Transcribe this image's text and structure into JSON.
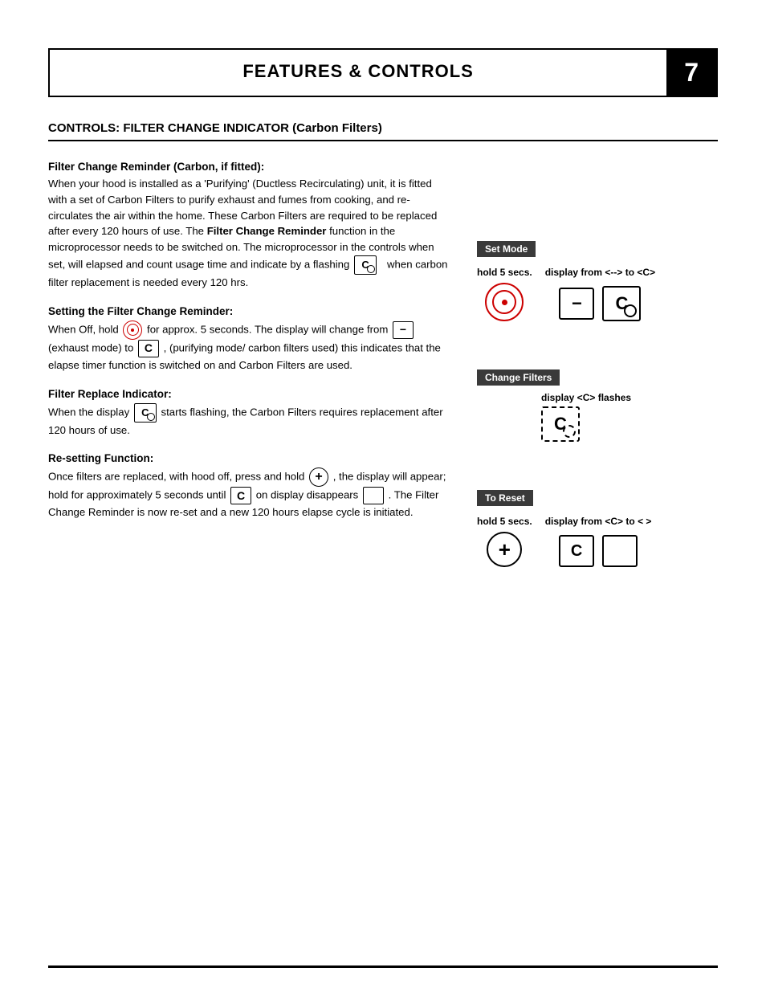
{
  "header": {
    "title": "FEATURES & CONTROLS",
    "page_number": "7"
  },
  "section_heading": "CONTROLS: FILTER CHANGE INDICATOR (Carbon Filters)",
  "filter_change_reminder": {
    "heading": "Filter Change Reminder (Carbon, if fitted):",
    "paragraph1": "When your hood is installed as a 'Purifying' (Ductless Recirculating) unit, it is fitted with a set of Carbon Filters to purify exhaust and fumes from cooking, and re-circulates the air within the home.  These Carbon Filters are required to be replaced after every 120 hours of use.  The ",
    "bold_text": "Filter Change Reminder",
    "paragraph2": " function in the microprocessor needs to be switched on.  The microprocessor in the controls when set, will elapsed and count usage time and indicate by a flashing ",
    "paragraph3": "   when carbon filter replacement is needed every 120 hrs."
  },
  "setting_filter": {
    "heading": "Setting the Filter Change Reminder:",
    "paragraph": "When Off, hold ",
    "para_mid1": "  for approx. 5 seconds. The display will change from ",
    "para_mid2": " (exhaust mode) to ",
    "para_mid3": " , (purifying mode/ carbon filters used) this indicates that the elapse timer function is switched on and Carbon Filters are used.",
    "diagram_label": "Set Mode",
    "hold_label": "hold 5 secs.",
    "display_label": "display from <--> to <C>"
  },
  "filter_replace": {
    "heading": "Filter Replace Indicator:",
    "paragraph1": "When the display ",
    "paragraph2": " starts flashing, the Carbon Filters requires replacement after 120 hours of use.",
    "diagram_label": "Change Filters",
    "display_label": "display <C> flashes"
  },
  "resetting": {
    "heading": "Re-setting Function:",
    "paragraph1": "Once filters are replaced, with hood off, press and hold ",
    "paragraph2": " , the display will appear; hold for approximately 5 seconds until ",
    "paragraph3": " on display disappears ",
    "paragraph4": " .  The Filter Change Reminder is now re-set and a new 120 hours elapse cycle is initiated.",
    "diagram_label": "To Reset",
    "hold_label": "hold 5 secs.",
    "display_label": "display from <C> to < >"
  }
}
